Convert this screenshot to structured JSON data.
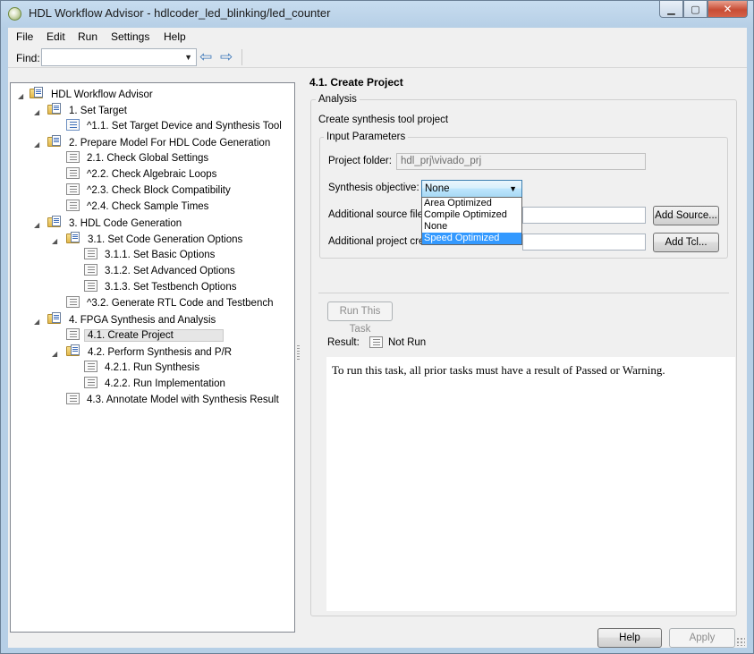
{
  "window": {
    "title": "HDL Workflow Advisor - hdlcoder_led_blinking/led_counter",
    "minimize_glyph": "▁",
    "maximize_glyph": "▢",
    "close_glyph": "✕"
  },
  "menu": [
    "File",
    "Edit",
    "Run",
    "Settings",
    "Help"
  ],
  "find": {
    "label": "Find:",
    "value": "",
    "arrow": "▼",
    "back_glyph": "⇦",
    "forward_glyph": "⇨"
  },
  "tree": [
    {
      "label": "HDL Workflow Advisor",
      "icon": "folder-icon",
      "expanded": true
    },
    {
      "label": "1. Set Target",
      "icon": "folder-icon",
      "expanded": true
    },
    {
      "label": "^1.1. Set Target Device and Synthesis Tool",
      "icon": "task-icon"
    },
    {
      "label": "2. Prepare Model For HDL Code Generation",
      "icon": "folder-icon",
      "expanded": true
    },
    {
      "label": "2.1. Check Global Settings",
      "icon": "task-icon"
    },
    {
      "label": "^2.2. Check Algebraic Loops",
      "icon": "task-icon"
    },
    {
      "label": "^2.3. Check Block Compatibility",
      "icon": "task-icon"
    },
    {
      "label": "^2.4. Check Sample Times",
      "icon": "task-icon"
    },
    {
      "label": "3. HDL Code Generation",
      "icon": "folder-icon",
      "expanded": true
    },
    {
      "label": "3.1. Set Code Generation Options",
      "icon": "folder-icon",
      "expanded": true
    },
    {
      "label": "3.1.1. Set Basic Options",
      "icon": "task-icon"
    },
    {
      "label": "3.1.2. Set Advanced Options",
      "icon": "task-icon"
    },
    {
      "label": "3.1.3. Set Testbench Options",
      "icon": "task-icon"
    },
    {
      "label": "^3.2. Generate RTL Code and Testbench",
      "icon": "task-icon"
    },
    {
      "label": "4. FPGA Synthesis and Analysis",
      "icon": "folder-icon",
      "expanded": true
    },
    {
      "label": "4.1. Create Project",
      "icon": "task-icon",
      "selected": true
    },
    {
      "label": "4.2. Perform Synthesis and P/R",
      "icon": "folder-icon",
      "expanded": true
    },
    {
      "label": "4.2.1. Run Synthesis",
      "icon": "task-icon"
    },
    {
      "label": "4.2.2. Run Implementation",
      "icon": "task-icon"
    },
    {
      "label": "4.3. Annotate Model with Synthesis Result",
      "icon": "task-icon"
    }
  ],
  "panel": {
    "heading": "4.1. Create Project",
    "analysis_title": "Analysis",
    "description": "Create synthesis tool project",
    "input_params_title": "Input Parameters",
    "project_folder_label": "Project folder:",
    "project_folder_value": "hdl_prj\\vivado_prj",
    "synthesis_objective_label": "Synthesis objective:",
    "synthesis_objective_value": "None",
    "synthesis_options": [
      "Area Optimized",
      "Compile Optimized",
      "None",
      "Speed Optimized"
    ],
    "highlighted_option": "Speed Optimized",
    "additional_source_label": "Additional source files:",
    "additional_source_value": "",
    "add_source_button": "Add Source...",
    "additional_project_label": "Additional project creation Tcl files:",
    "additional_project_value": "",
    "add_tcl_button": "Add Tcl...",
    "run_task_button": "Run This Task",
    "result_label": "Result:",
    "result_value": "Not Run",
    "result_message": "To run this task, all prior tasks must have a result of Passed or Warning."
  },
  "footer": {
    "help_button": "Help",
    "apply_button": "Apply"
  },
  "colors": {
    "selection": "#3399ff",
    "title_gradient": "#b6cfe6",
    "close_button": "#c84d35"
  }
}
